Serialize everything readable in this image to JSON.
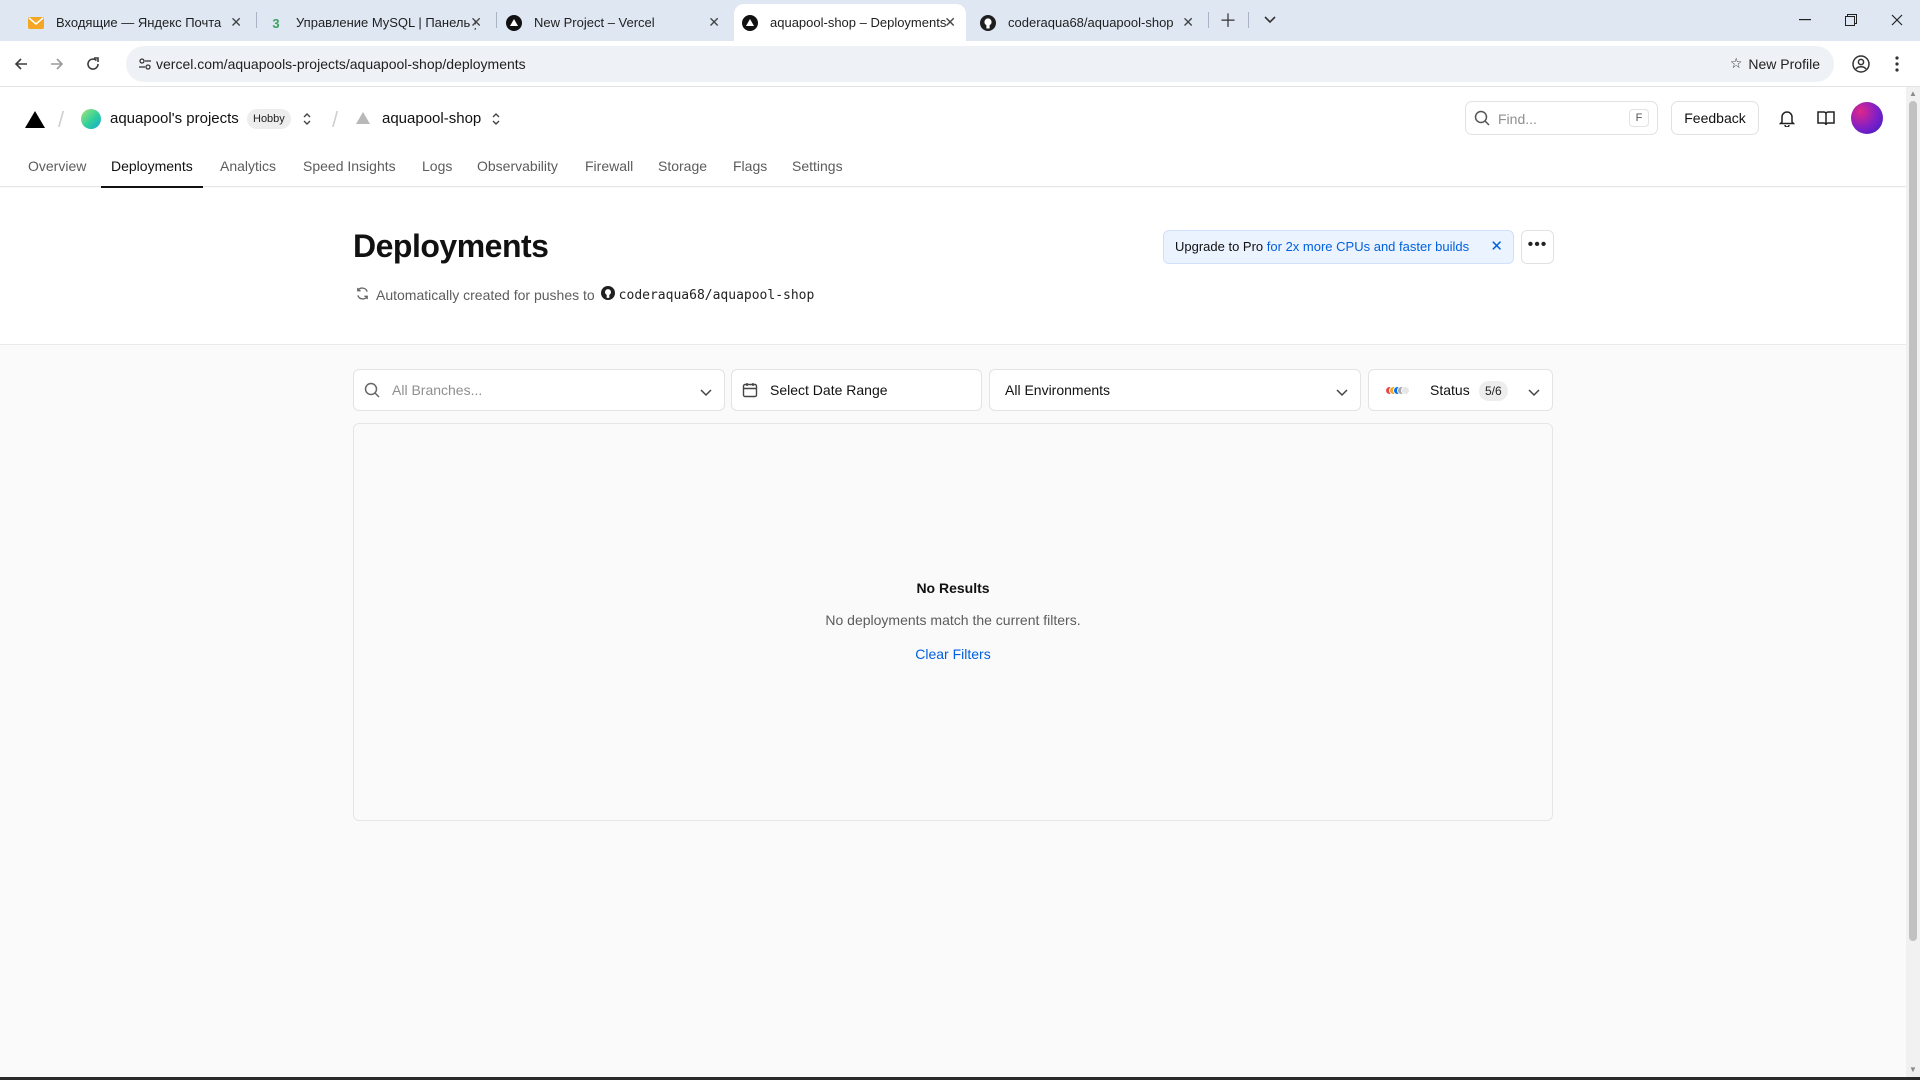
{
  "browser": {
    "tabs": [
      {
        "label": "Входящие — Яндекс Почта",
        "icon": "mail-icon"
      },
      {
        "label": "Управление MySQL | Панель у",
        "icon": "beget-icon"
      },
      {
        "label": "New Project – Vercel",
        "icon": "vercel-icon"
      },
      {
        "label": "aquapool-shop – Deployments",
        "icon": "vercel-icon"
      },
      {
        "label": "coderaqua68/aquapool-shop",
        "icon": "github-icon"
      }
    ],
    "active_tab_index": 3,
    "url": "vercel.com/aquapools-projects/aquapool-shop/deployments",
    "new_profile_label": "New Profile"
  },
  "header": {
    "team_name": "aquapool's projects",
    "plan_badge": "Hobby",
    "project_name": "aquapool-shop",
    "find_placeholder": "Find...",
    "find_shortcut": "F",
    "feedback_label": "Feedback"
  },
  "nav_tabs": [
    "Overview",
    "Deployments",
    "Analytics",
    "Speed Insights",
    "Logs",
    "Observability",
    "Firewall",
    "Storage",
    "Flags",
    "Settings"
  ],
  "active_nav": "Deployments",
  "page": {
    "title": "Deployments",
    "subtitle": "Automatically created for pushes to",
    "repo": "coderaqua68/aquapool-shop",
    "upgrade_bold": "Upgrade to Pro",
    "upgrade_link": "for 2x more CPUs and faster builds"
  },
  "filters": {
    "branches_placeholder": "All Branches...",
    "date_range": "Select Date Range",
    "environments": "All Environments",
    "status_label": "Status",
    "status_count": "5/6",
    "status_colors": [
      "#e5484d",
      "#f5a623",
      "#0070f3",
      "#a8a8a8",
      "#e6e6e6"
    ]
  },
  "empty_state": {
    "title": "No Results",
    "message": "No deployments match the current filters.",
    "clear_label": "Clear Filters"
  }
}
